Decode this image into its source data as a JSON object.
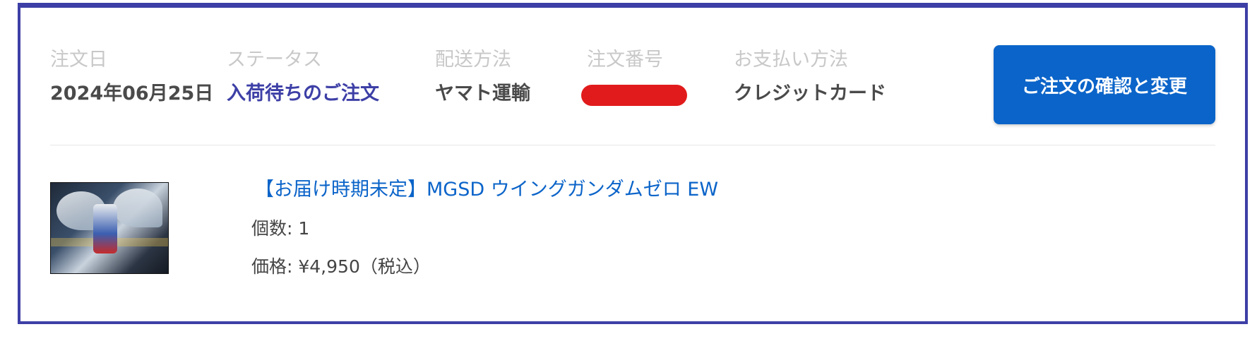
{
  "order": {
    "fields": [
      {
        "label": "注文日",
        "value": "2024年06月25日"
      },
      {
        "label": "ステータス",
        "value": "入荷待ちのご注文"
      },
      {
        "label": "配送方法",
        "value": "ヤマト運輸"
      },
      {
        "label": "注文番号",
        "value": ""
      },
      {
        "label": "お支払い方法",
        "value": "クレジットカード"
      }
    ],
    "confirm_button_label": "ご注文の確認と変更"
  },
  "product": {
    "title": "【お届け時期未定】MGSD ウイングガンダムゼロ EW",
    "quantity": "個数: 1",
    "price": "価格: ¥4,950（税込）"
  },
  "colors": {
    "border": "#3d3fa6",
    "status": "#3d3fa6",
    "button": "#0b64c9",
    "link": "#0b64c9",
    "redaction": "#e11b1b"
  }
}
